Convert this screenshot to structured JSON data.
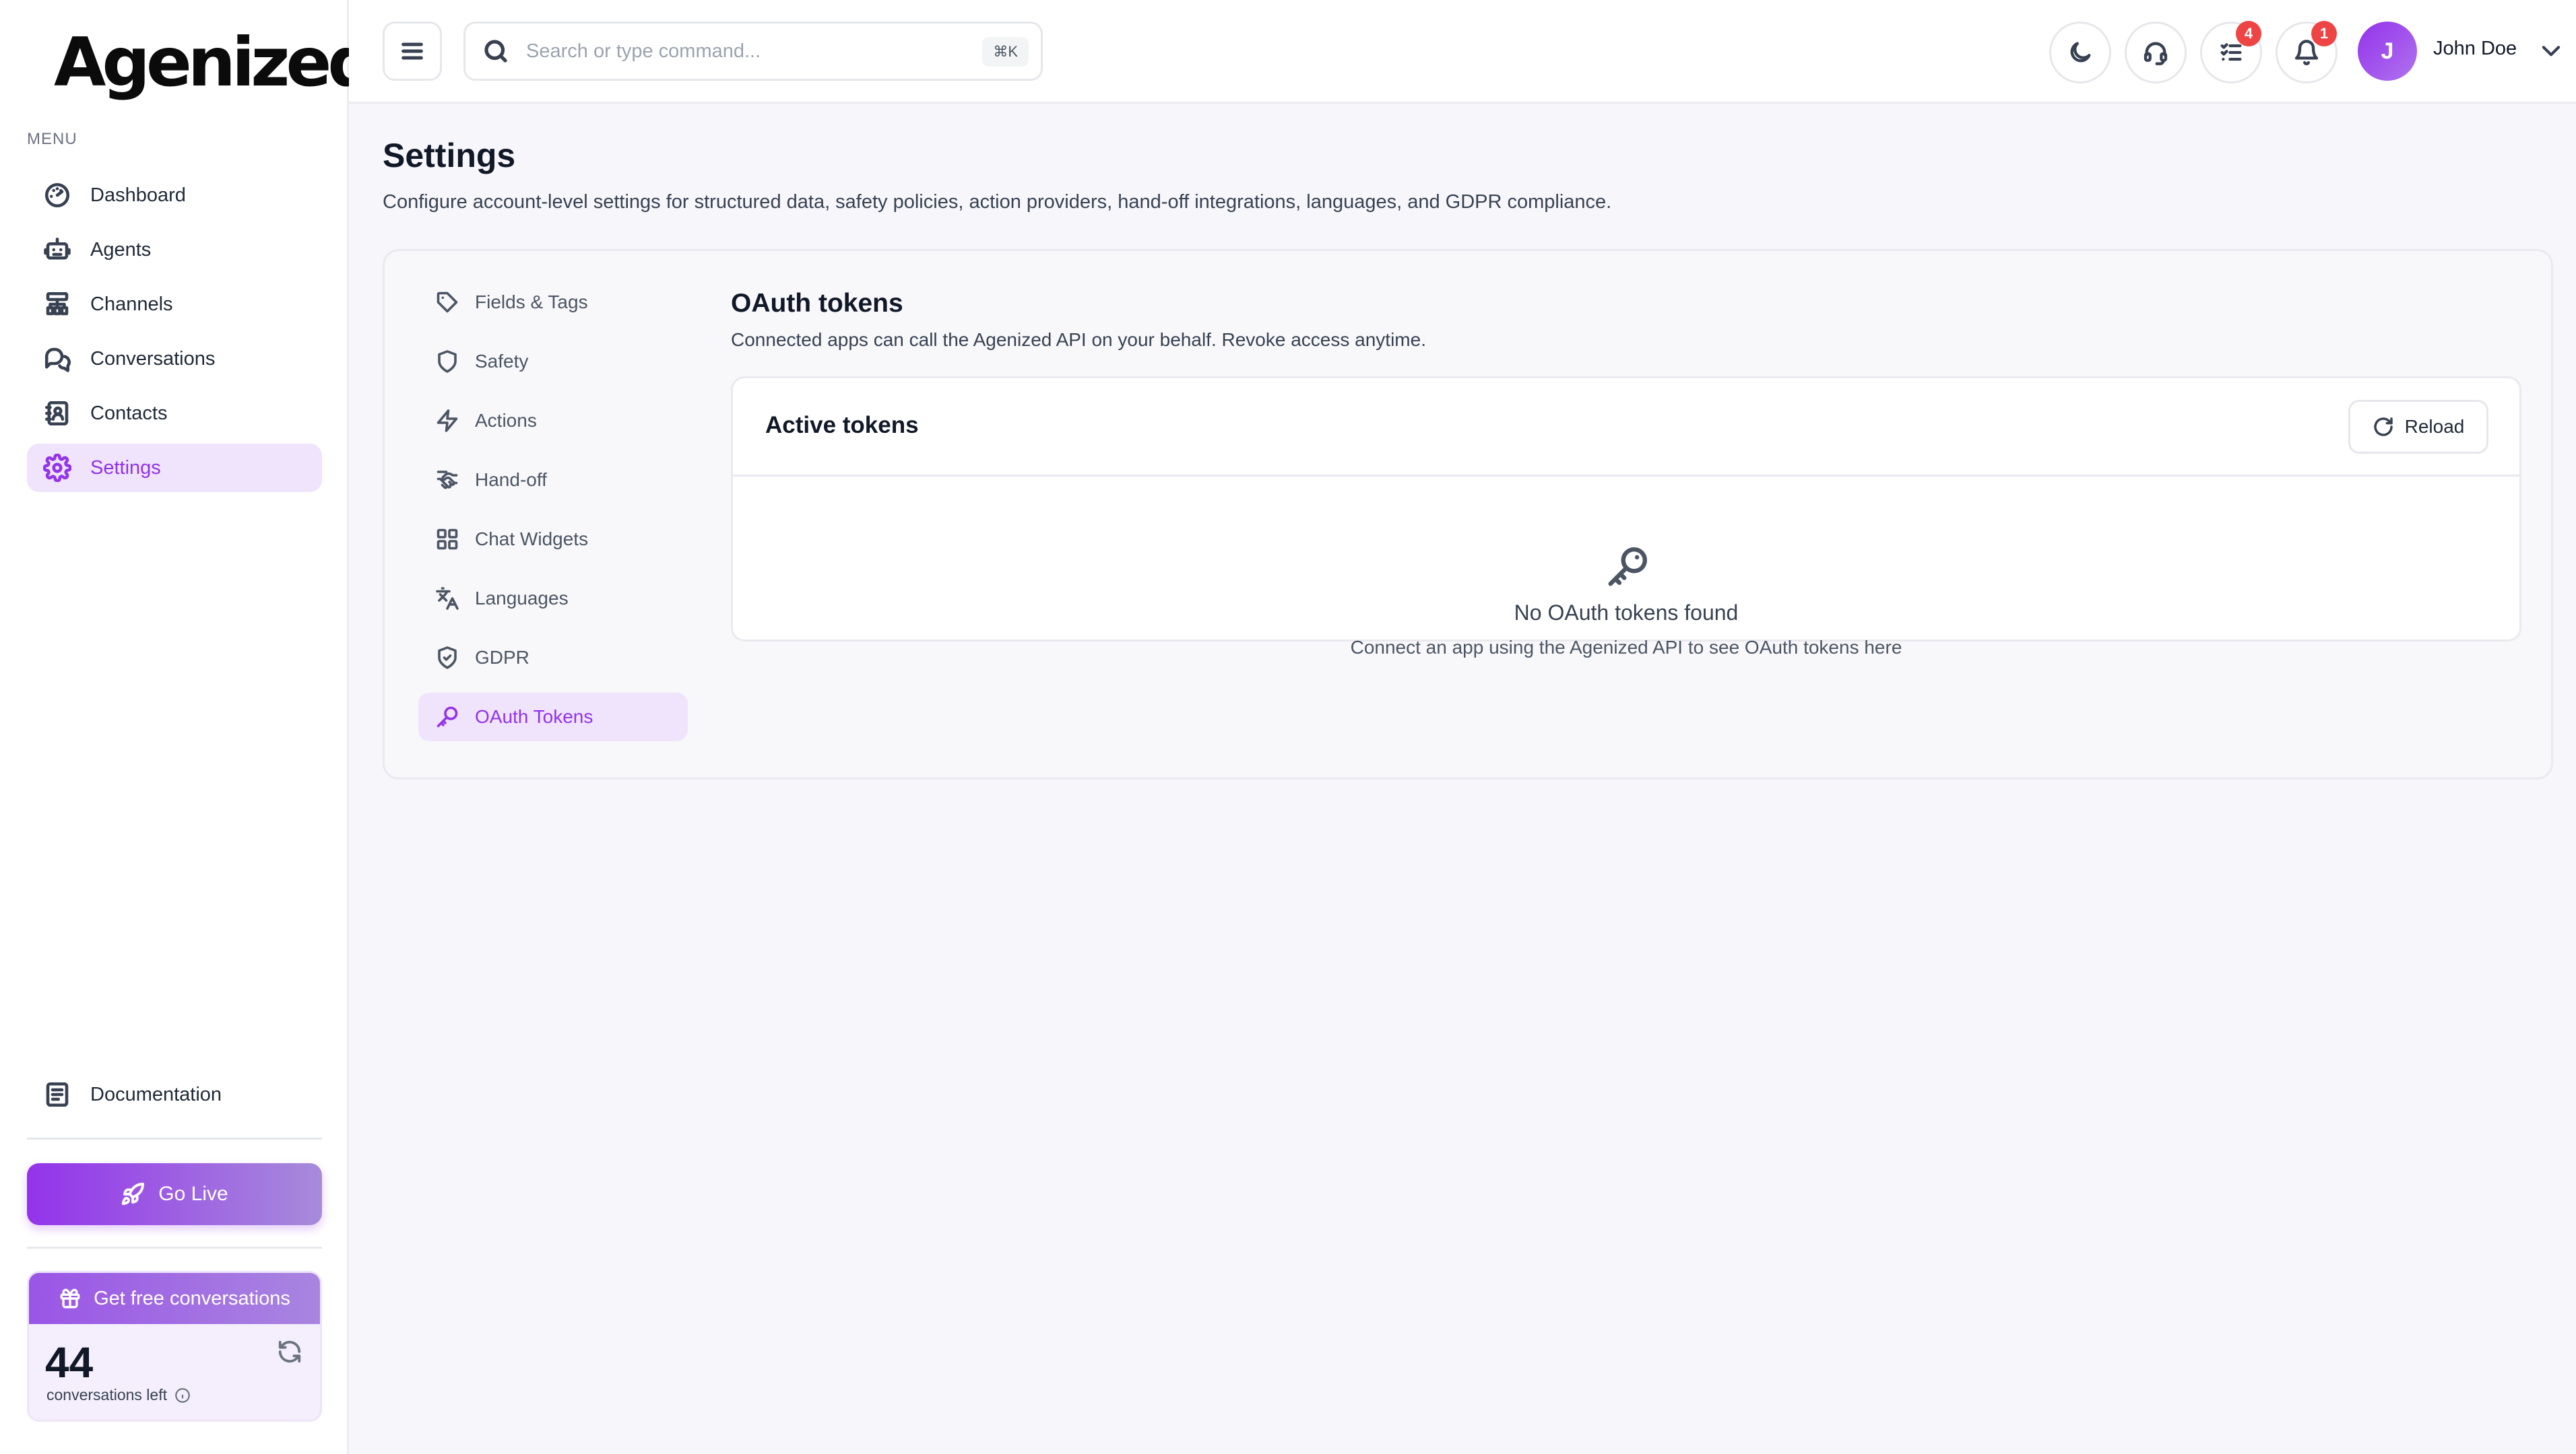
{
  "brand": {
    "logo_text": "Agenized",
    "accent": "#9333ea"
  },
  "sidebar": {
    "menu_label": "MENU",
    "items": [
      {
        "label": "Dashboard",
        "icon": "dashboard-gauge-icon",
        "active": false
      },
      {
        "label": "Agents",
        "icon": "robot-icon",
        "active": false
      },
      {
        "label": "Channels",
        "icon": "sitemap-icon",
        "active": false
      },
      {
        "label": "Conversations",
        "icon": "chat-bubbles-icon",
        "active": false
      },
      {
        "label": "Contacts",
        "icon": "contact-book-icon",
        "active": false
      },
      {
        "label": "Settings",
        "icon": "gear-icon",
        "active": true
      }
    ],
    "documentation_label": "Documentation",
    "go_live_label": "Go Live",
    "promo": {
      "header_label": "Get free conversations",
      "count": "44",
      "sub_label": "conversations left"
    }
  },
  "topbar": {
    "search": {
      "placeholder": "Search or type command...",
      "shortcut": "⌘K"
    },
    "tasks_badge": "4",
    "notifications_badge": "1",
    "user": {
      "initial": "J",
      "name": "John Doe"
    }
  },
  "page": {
    "title": "Settings",
    "description": "Configure account-level settings for structured data, safety policies, action providers, hand-off integrations, languages, and GDPR compliance."
  },
  "settings_nav": [
    {
      "label": "Fields & Tags",
      "icon": "tag-icon",
      "active": false
    },
    {
      "label": "Safety",
      "icon": "shield-icon",
      "active": false
    },
    {
      "label": "Actions",
      "icon": "lightning-icon",
      "active": false
    },
    {
      "label": "Hand-off",
      "icon": "handshake-icon",
      "active": false
    },
    {
      "label": "Chat Widgets",
      "icon": "widgets-grid-icon",
      "active": false
    },
    {
      "label": "Languages",
      "icon": "translate-icon",
      "active": false
    },
    {
      "label": "GDPR",
      "icon": "shield-check-icon",
      "active": false
    },
    {
      "label": "OAuth Tokens",
      "icon": "key-icon",
      "active": true
    }
  ],
  "oauth": {
    "title": "OAuth tokens",
    "description": "Connected apps can call the Agenized API on your behalf. Revoke access anytime.",
    "card_title": "Active tokens",
    "reload_label": "Reload",
    "empty_title": "No OAuth tokens found",
    "empty_description": "Connect an app using the Agenized API to see OAuth tokens here"
  }
}
